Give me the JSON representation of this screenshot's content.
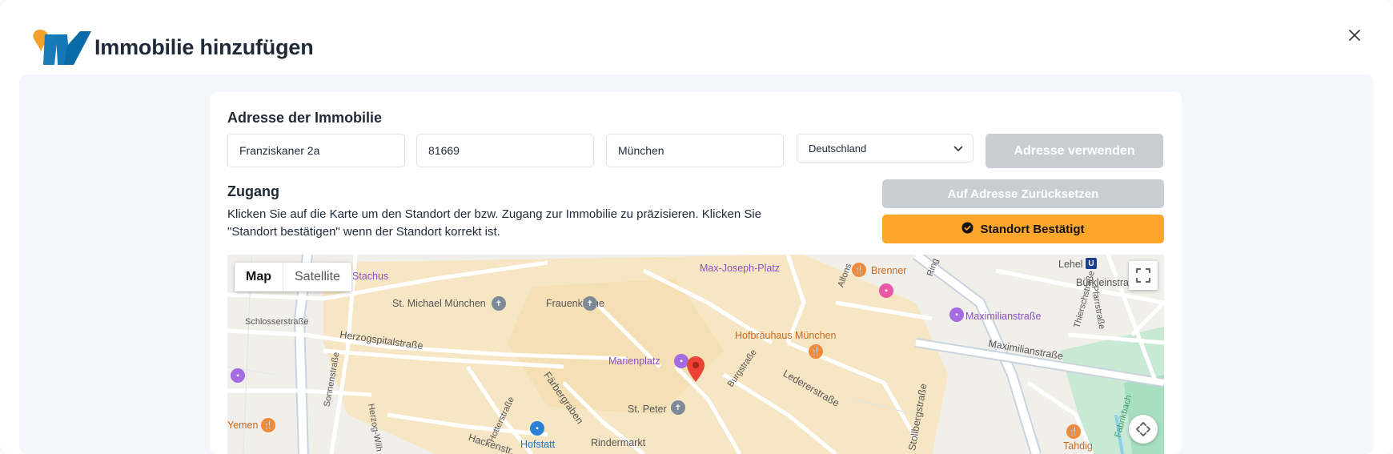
{
  "modal": {
    "title": "Immobilie hinzufügen"
  },
  "address": {
    "heading": "Adresse der Immobilie",
    "street": "Franziskaner 2a",
    "zip": "81669",
    "city": "München",
    "country": "Deutschland",
    "use_button": "Adresse verwenden"
  },
  "access": {
    "heading": "Zugang",
    "description_line1": "Klicken Sie auf die Karte um den Standort der bzw. Zugang zur Immobilie zu präzisieren. Klicken Sie",
    "description_line2": "\"Standort bestätigen\" wenn der Standort korrekt ist.",
    "reset_button": "Auf Adresse Zurücksetzen",
    "confirm_button": "Standort Bestätigt"
  },
  "map": {
    "type_map": "Map",
    "type_satellite": "Satellite",
    "labels": {
      "stachus": "Stachus",
      "max_joseph": "Max-Joseph-Platz",
      "brenner": "Brenner",
      "lehel": "Lehel",
      "buerklein": "Bürkleinstraße",
      "michael": "St. Michael München",
      "frauenkirche": "Frauenkirche",
      "maximilianstr_poi": "Maximilianstraße",
      "schlosser": "Schlosserstraße",
      "herzogspital": "Herzogspitalstraße",
      "hofbraeuhaus": "Hofbräuhaus München",
      "maximilianstr_road": "Maximilianstraße",
      "marienplatz": "Marienplatz",
      "burgstr": "Burgstraße",
      "ledererstr": "Ledererstraße",
      "sonnenstr": "Sonnenstraße",
      "faerbergraben": "Färbergraben",
      "st_peter": "St. Peter",
      "yemen": "Yemen",
      "hofstatt": "Hofstatt",
      "rindermarkt": "Rindermarkt",
      "hackenstr": "Hackenstr.",
      "hotterstr": "Hotterstraße",
      "stollberg": "Stollbergstraße",
      "tahdig": "Tahdig",
      "thiersch": "Thierschstraße",
      "pfarr": "Pfarrstraße",
      "fabrikbach": "Fabrikbach",
      "ring": "Ring",
      "alfons": "Alfons",
      "herzog_wilhelm": "Herzog-Wilh",
      "u_badge": "U"
    }
  },
  "colors": {
    "accent": "#fca62c",
    "disabled": "#c9cdd4",
    "pin": "#ea4335"
  }
}
